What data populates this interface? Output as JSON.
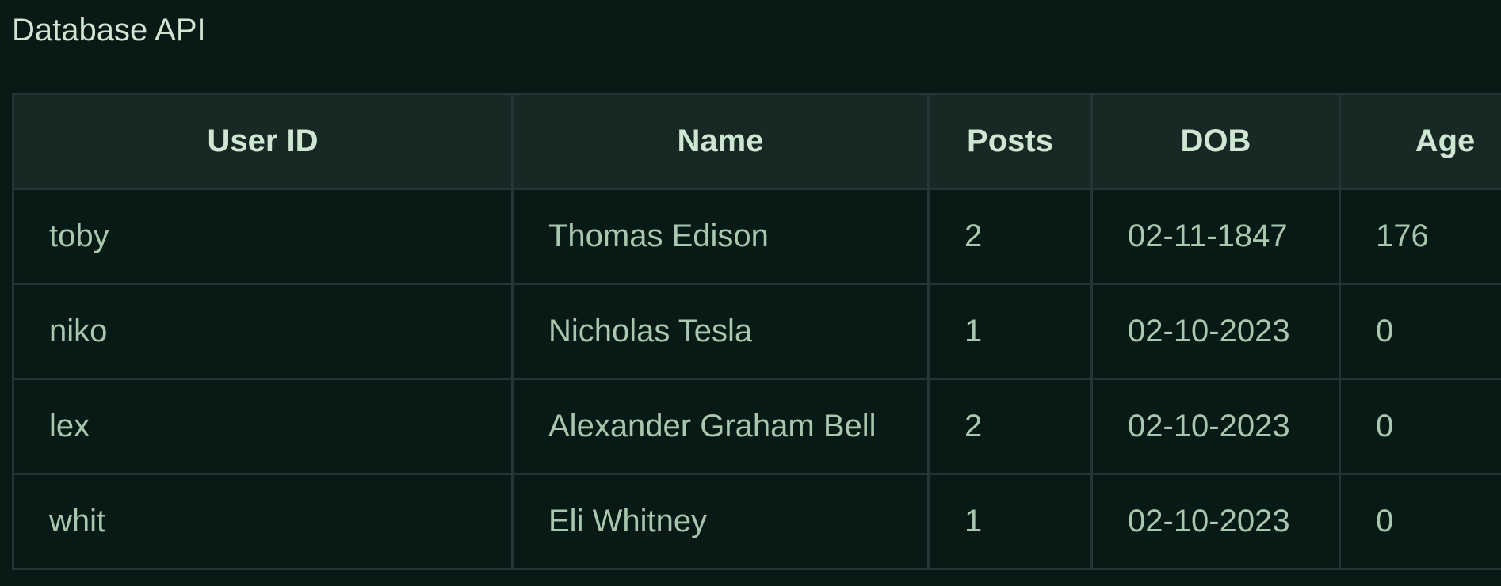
{
  "page": {
    "title": "Database API"
  },
  "table": {
    "columns": [
      "User ID",
      "Name",
      "Posts",
      "DOB",
      "Age"
    ],
    "rows": [
      {
        "user_id": "toby",
        "name": "Thomas Edison",
        "posts": "2",
        "dob": "02-11-1847",
        "age": "176"
      },
      {
        "user_id": "niko",
        "name": "Nicholas Tesla",
        "posts": "1",
        "dob": "02-10-2023",
        "age": "0"
      },
      {
        "user_id": "lex",
        "name": "Alexander Graham Bell",
        "posts": "2",
        "dob": "02-10-2023",
        "age": "0"
      },
      {
        "user_id": "whit",
        "name": "Eli Whitney",
        "posts": "1",
        "dob": "02-10-2023",
        "age": "0"
      }
    ]
  },
  "colors": {
    "background": "#081a16",
    "header_background": "#172924",
    "border": "#223733",
    "header_text": "#cfe6d2",
    "cell_text": "#a9c6ae"
  }
}
